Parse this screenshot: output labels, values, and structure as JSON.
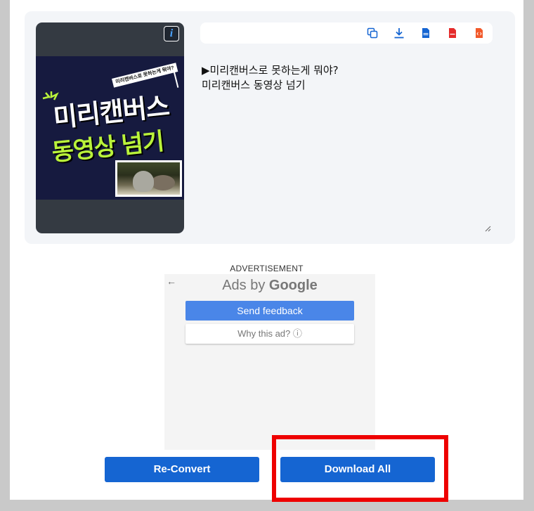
{
  "thumbnail": {
    "info_icon_glyph": "i",
    "ribbon_text": "미리캔버스로 못하는게 뭐야?",
    "title_line1": "미리캔버스",
    "title_line2": "동영상 넘기",
    "colors": {
      "poster_bg": "#161a3f",
      "accent": "#b9f23a"
    }
  },
  "toolbar": {
    "icons": [
      "copy-icon",
      "download-icon",
      "doc-icon",
      "pdf-icon",
      "html-code-icon"
    ]
  },
  "editor": {
    "text": "▶미리캔버스로 못하는게 뭐야?\n미리캔버스 동영상 넘기"
  },
  "ad": {
    "label": "ADVERTISEMENT",
    "ads_by_prefix": "Ads by ",
    "ads_by_brand": "Google",
    "send_feedback": "Send feedback",
    "why_this_ad": "Why this ad? ⓘ"
  },
  "buttons": {
    "reconvert": "Re-Convert",
    "download_all": "Download All"
  },
  "colors": {
    "primary_button": "#1565d2",
    "highlight": "#ee0000"
  }
}
